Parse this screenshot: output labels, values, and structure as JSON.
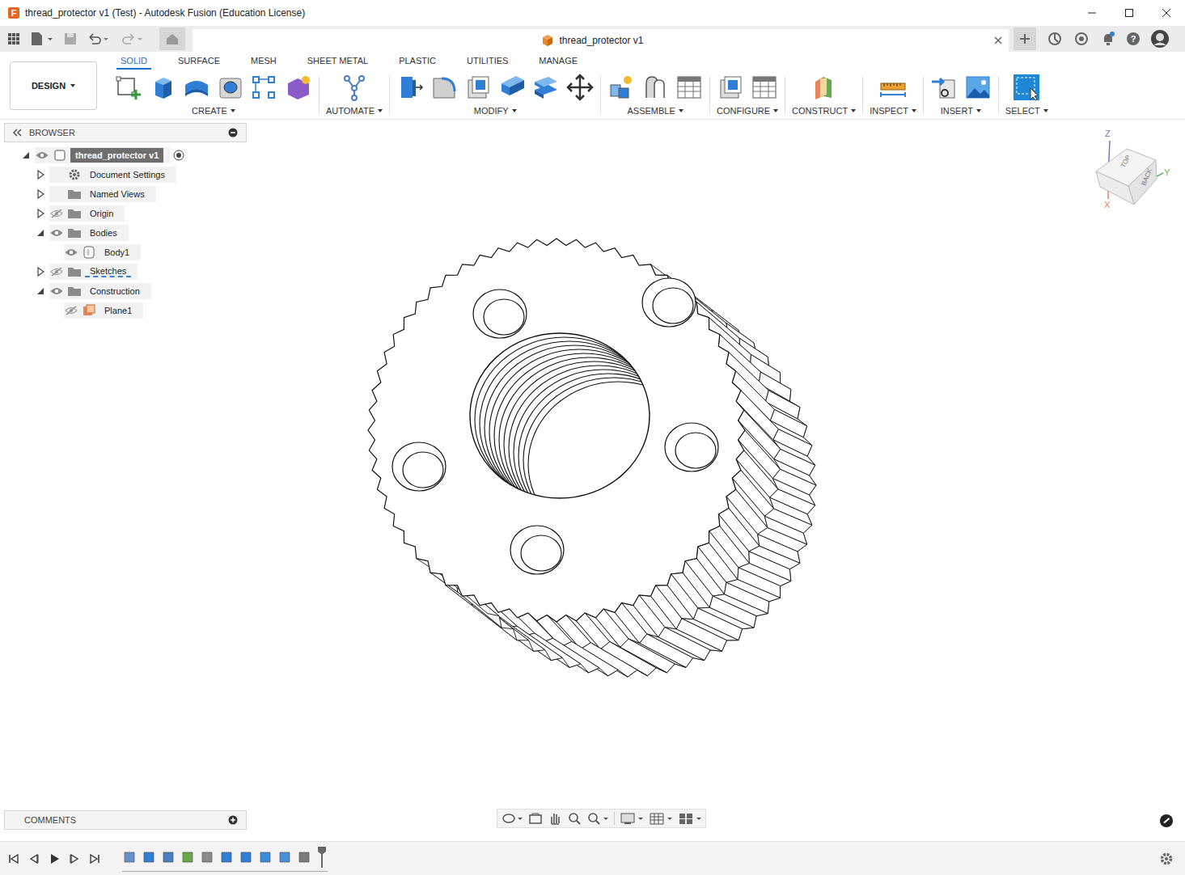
{
  "window": {
    "title": "thread_protector v1 (Test) - Autodesk Fusion (Education License)",
    "logo": "F"
  },
  "document_tab": {
    "label": "thread_protector v1"
  },
  "help": "?",
  "workspace": {
    "label": "DESIGN",
    "dropdown": true
  },
  "tabs": [
    {
      "label": "SOLID",
      "selected": true
    },
    {
      "label": "SURFACE",
      "selected": false
    },
    {
      "label": "MESH",
      "selected": false
    },
    {
      "label": "SHEET METAL",
      "selected": false
    },
    {
      "label": "PLASTIC",
      "selected": false
    },
    {
      "label": "UTILITIES",
      "selected": false
    },
    {
      "label": "MANAGE",
      "selected": false
    }
  ],
  "groups": [
    {
      "label": "CREATE",
      "dropdown": true
    },
    {
      "label": "AUTOMATE",
      "dropdown": true
    },
    {
      "label": "MODIFY",
      "dropdown": true
    },
    {
      "label": "ASSEMBLE",
      "dropdown": true
    },
    {
      "label": "CONFIGURE",
      "dropdown": true
    },
    {
      "label": "CONSTRUCT",
      "dropdown": true
    },
    {
      "label": "INSPECT",
      "dropdown": true
    },
    {
      "label": "INSERT",
      "dropdown": true
    },
    {
      "label": "SELECT",
      "dropdown": true
    }
  ],
  "browser": {
    "title": "BROWSER",
    "items": [
      {
        "label": "thread_protector v1",
        "depth": 0,
        "kind": "component",
        "has_children": true,
        "expanded": true,
        "visible": true,
        "selected": true,
        "active": true,
        "flagged": false
      },
      {
        "label": "Document Settings",
        "depth": 1,
        "kind": "settings",
        "has_children": true,
        "expanded": false,
        "visible": false,
        "selected": false,
        "active": false,
        "flagged": false
      },
      {
        "label": "Named Views",
        "depth": 1,
        "kind": "views",
        "has_children": true,
        "expanded": false,
        "visible": false,
        "selected": false,
        "active": false,
        "flagged": false
      },
      {
        "label": "Origin",
        "depth": 1,
        "kind": "folder",
        "has_children": true,
        "expanded": false,
        "visible": false,
        "selected": false,
        "active": false,
        "flagged": false
      },
      {
        "label": "Bodies",
        "depth": 1,
        "kind": "folder",
        "has_children": true,
        "expanded": true,
        "visible": true,
        "selected": false,
        "active": false,
        "flagged": false
      },
      {
        "label": "Body1",
        "depth": 2,
        "kind": "body",
        "has_children": false,
        "expanded": false,
        "visible": true,
        "selected": false,
        "active": false,
        "flagged": false
      },
      {
        "label": "Sketches",
        "depth": 1,
        "kind": "folder",
        "has_children": true,
        "expanded": false,
        "visible": false,
        "selected": false,
        "active": false,
        "flagged": true
      },
      {
        "label": "Construction",
        "depth": 1,
        "kind": "folder",
        "has_children": true,
        "expanded": true,
        "visible": true,
        "selected": false,
        "active": false,
        "flagged": false
      },
      {
        "label": "Plane1",
        "depth": 2,
        "kind": "plane",
        "has_children": false,
        "expanded": false,
        "visible": false,
        "selected": false,
        "active": false,
        "flagged": false
      }
    ]
  },
  "viewcube": {
    "faces": [
      {
        "label": "TOP"
      },
      {
        "label": "BACK"
      }
    ],
    "axes": [
      {
        "label": "Z",
        "color": "#8a6cc0"
      },
      {
        "label": "Y",
        "color": "#5cb85c"
      },
      {
        "label": "X",
        "color": "#e8865a"
      }
    ]
  },
  "comments": {
    "title": "COMMENTS"
  }
}
